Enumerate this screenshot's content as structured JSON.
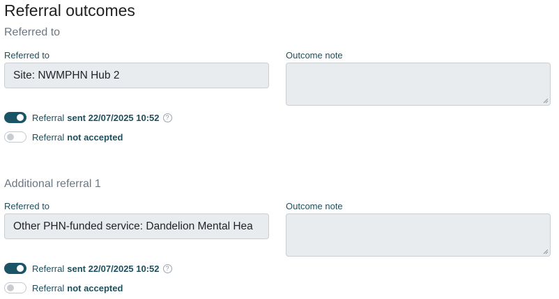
{
  "page": {
    "title": "Referral outcomes"
  },
  "referrals": [
    {
      "section_title": "Referred to",
      "referred_to_label": "Referred to",
      "referred_to_value": "Site: NWMPHN Hub 2",
      "outcome_note_label": "Outcome note",
      "outcome_note_value": "",
      "sent_toggle": {
        "on": true,
        "prefix": "Referral",
        "status": "sent 22/07/2025 10:52",
        "help": "?"
      },
      "accepted_toggle": {
        "on": false,
        "prefix": "Referral",
        "status": "not accepted"
      }
    },
    {
      "section_title": "Additional referral 1",
      "referred_to_label": "Referred to",
      "referred_to_value": "Other PHN-funded service: Dandelion Mental Hea",
      "outcome_note_label": "Outcome note",
      "outcome_note_value": "",
      "sent_toggle": {
        "on": true,
        "prefix": "Referral",
        "status": "sent 22/07/2025 10:52",
        "help": "?"
      },
      "accepted_toggle": {
        "on": false,
        "prefix": "Referral",
        "status": "not accepted"
      }
    }
  ],
  "colors": {
    "accent": "#1b5467",
    "label": "#1d4f5c",
    "input_bg": "#e9ecef",
    "section": "#6b7680"
  }
}
